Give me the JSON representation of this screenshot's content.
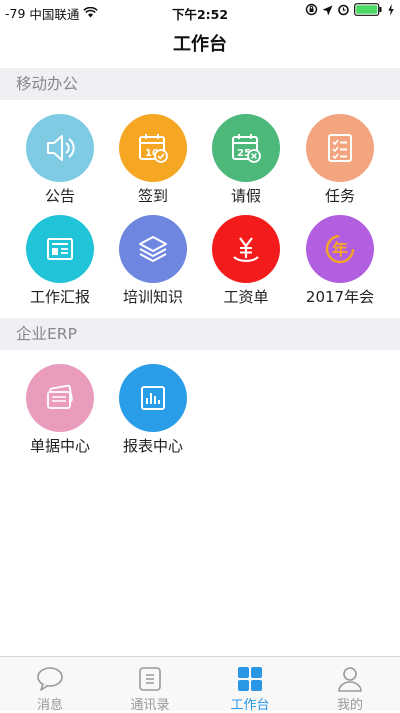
{
  "status_bar": {
    "signal": "-79",
    "carrier": "中国联通",
    "time": "下午2:52"
  },
  "nav": {
    "title": "工作台"
  },
  "sections": [
    {
      "title": "移动办公",
      "items": [
        {
          "label": "公告",
          "icon": "speaker-icon",
          "color": "#7ecbe3"
        },
        {
          "label": "签到",
          "icon": "calendar-check-icon",
          "color": "#f5a623"
        },
        {
          "label": "请假",
          "icon": "calendar-cancel-icon",
          "color": "#4cb87a"
        },
        {
          "label": "任务",
          "icon": "checklist-icon",
          "color": "#f2a57f"
        },
        {
          "label": "工作汇报",
          "icon": "report-card-icon",
          "color": "#21c3d9"
        },
        {
          "label": "培训知识",
          "icon": "layers-icon",
          "color": "#6f86e0"
        },
        {
          "label": "工资单",
          "icon": "yen-icon",
          "color": "#f31b1b"
        },
        {
          "label": "2017年会",
          "icon": "annual-meeting-icon",
          "color": "#b15ee0"
        }
      ]
    },
    {
      "title": "企业ERP",
      "items": [
        {
          "label": "单据中心",
          "icon": "documents-icon",
          "color": "#ea9cbc"
        },
        {
          "label": "报表中心",
          "icon": "bar-chart-icon",
          "color": "#2a9de8"
        }
      ]
    }
  ],
  "tabs": [
    {
      "label": "消息",
      "icon": "message-bubble-icon",
      "active": false
    },
    {
      "label": "通讯录",
      "icon": "contacts-book-icon",
      "active": false
    },
    {
      "label": "工作台",
      "icon": "workbench-grid-icon",
      "active": true
    },
    {
      "label": "我的",
      "icon": "profile-icon",
      "active": false
    }
  ],
  "colors": {
    "accent": "#2a97e6",
    "section_bg": "#efeff4",
    "inactive_tab": "#999999"
  }
}
